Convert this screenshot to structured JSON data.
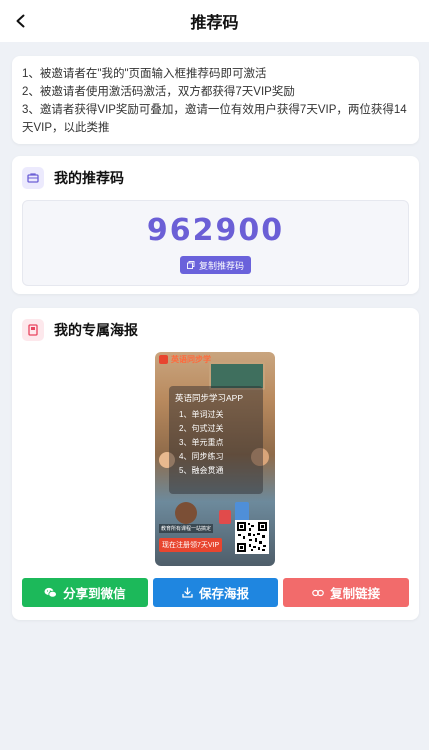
{
  "nav": {
    "title": "推荐码"
  },
  "rules": [
    "1、被邀请者在\"我的\"页面输入框推荐码即可激活",
    "2、被邀请者使用激活码激活，双方都获得7天VIP奖励",
    "3、邀请者获得VIP奖励可叠加，邀请一位有效用户获得7天VIP，两位获得14天VIP，以此类推"
  ],
  "code_section": {
    "title": "我的推荐码",
    "code": "962900",
    "copy_label": "复制推荐码"
  },
  "poster_section": {
    "title": "我的专属海报",
    "poster": {
      "brand": "英语同步学",
      "panel_title": "英语同步学习APP",
      "items": [
        "1、单词过关",
        "2、句式过关",
        "3、单元重点",
        "4、同步练习",
        "5、融会贯通"
      ],
      "note": "教育所有课程一站搞定",
      "cta": "现在注册领7天VIP"
    },
    "buttons": {
      "share": "分享到微信",
      "save": "保存海报",
      "copy_link": "复制链接"
    }
  },
  "colors": {
    "accent": "#6b5fd6",
    "green": "#1cb95a",
    "blue": "#1f86e0",
    "red": "#f26b6b"
  }
}
